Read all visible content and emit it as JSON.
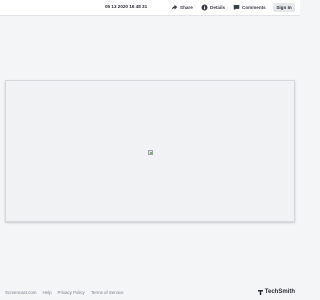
{
  "header": {
    "timestamp": "05 13 2020 16 48 31",
    "share_label": "Share",
    "details_label": "Details",
    "comments_label": "Comments",
    "signin_label": "Sign In"
  },
  "footer": {
    "links": [
      "Screencast.com",
      "Help",
      "Privacy Policy",
      "Terms of Service"
    ]
  },
  "brand": {
    "name": "TechSmith"
  }
}
